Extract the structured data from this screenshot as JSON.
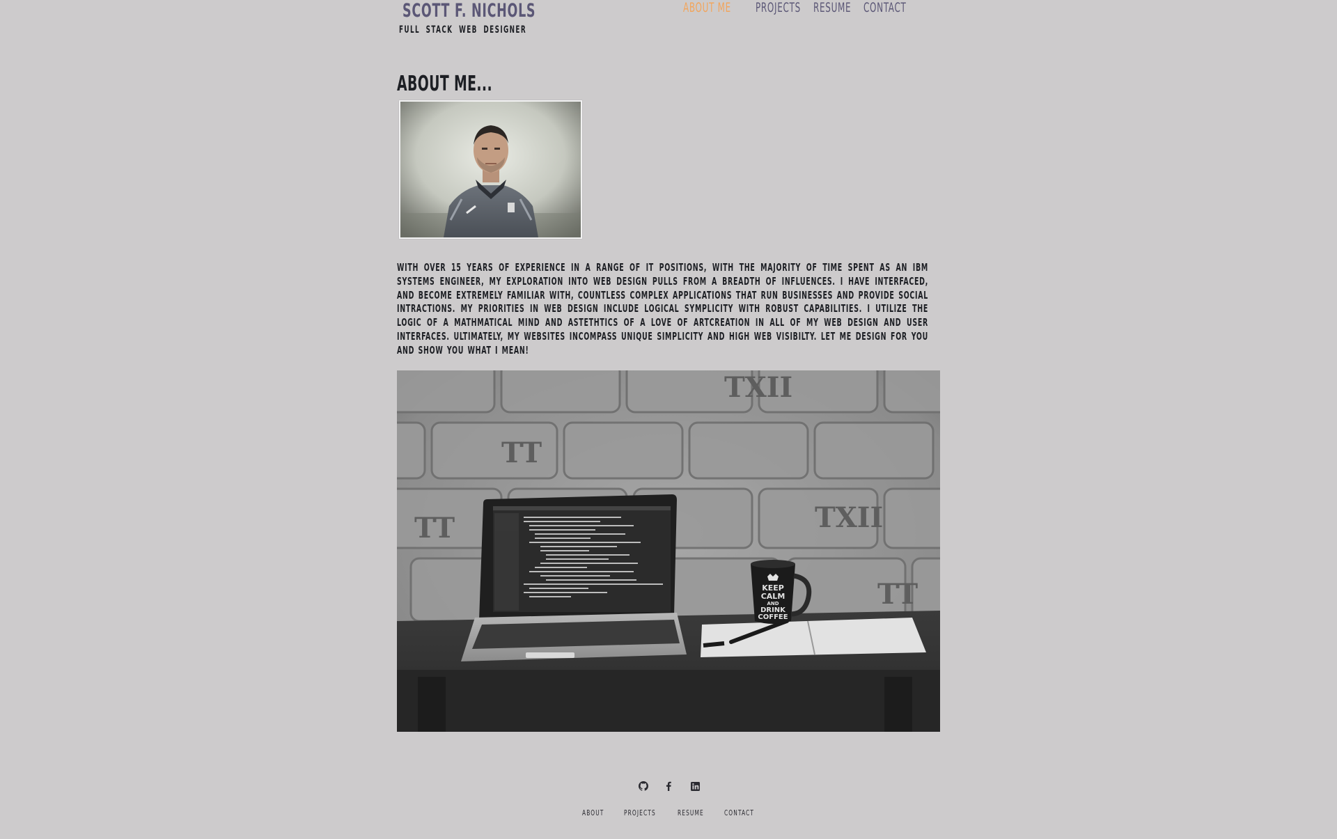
{
  "brand": {
    "name": "SCOTT F. NICHOLS",
    "tagline": "FULL STACK WEB DESIGNER"
  },
  "nav": {
    "items": [
      {
        "label": "ABOUT ME",
        "active": true
      },
      {
        "label": "PROJECTS",
        "active": false
      },
      {
        "label": "RESUME",
        "active": false
      },
      {
        "label": "CONTACT",
        "active": false
      }
    ]
  },
  "about": {
    "title": "ABOUT ME...",
    "portrait_icon": "portrait-photo",
    "bio": "WITH OVER 15 YEARS OF EXPERIENCE IN A RANGE OF IT POSITIONS, WITH THE MAJORITY OF TIME SPENT AS AN IBM SYSTEMS ENGINEER, MY EXPLORATION INTO WEB DESIGN PULLS FROM A BREADTH OF INFLUENCES. I HAVE INTERFACED, AND BECOME EXTREMELY FAMILIAR WITH, COUNTLESS COMPLEX APPLICATIONS THAT RUN BUSINESSES AND PROVIDE SOCIAL INTRACTIONS. MY PRIORITIES IN WEB DESIGN INCLUDE LOGICAL SYMPLICITY WITH ROBUST CAPABILITIES. I UTILIZE THE LOGIC OF A MATHMATICAL MIND AND ASTETHTICS OF A LOVE OF ARTCREATION IN ALL OF MY WEB DESIGN AND USER INTERFACES. ULTIMATELY, MY WEBSITES INCOMPASS UNIQUE SIMPLICITY AND HIGH WEB VISIBILTY. LET ME DESIGN FOR YOU AND SHOW YOU WHAT I MEAN!",
    "workspace_mug_text": [
      "KEEP",
      "CALM",
      "AND",
      "DRINK",
      "COFFEE"
    ],
    "wall_marks": [
      "TXII",
      "TT",
      "TT",
      "TXII",
      "TT"
    ]
  },
  "footer": {
    "icons": [
      "github-icon",
      "facebook-icon",
      "linkedin-icon"
    ],
    "links": [
      "ABOUT",
      "PROJECTS",
      "RESUME",
      "CONTACT"
    ]
  },
  "colors": {
    "background": "#cdcbcc",
    "brand": "#5b5776",
    "accent": "#f2a55c",
    "text": "#1d1f24"
  }
}
